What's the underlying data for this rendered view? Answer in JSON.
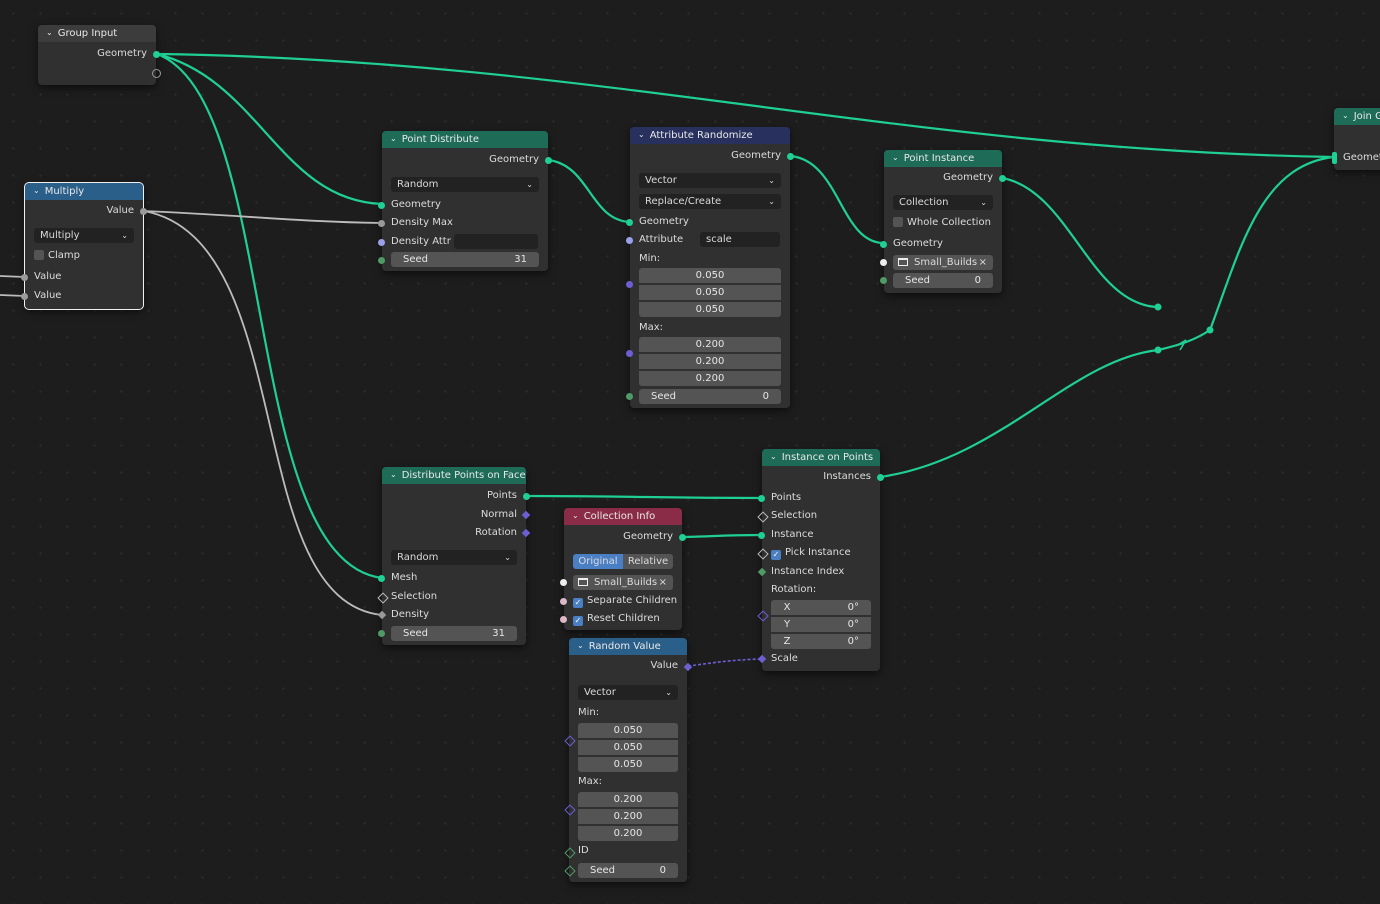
{
  "nodes": {
    "group_input": {
      "title": "Group Input",
      "geometry": "Geometry"
    },
    "multiply": {
      "title": "Multiply",
      "value_out": "Value",
      "operation": "Multiply",
      "clamp": "Clamp",
      "value_in_1": "Value",
      "value_in_2": "Value"
    },
    "point_distribute": {
      "title": "Point Distribute",
      "geometry_out": "Geometry",
      "mode": "Random",
      "geometry_in": "Geometry",
      "density_max": "Density Max",
      "density_attr": "Density Attr",
      "seed_label": "Seed",
      "seed_value": "31"
    },
    "attribute_randomize": {
      "title": "Attribute Randomize",
      "geometry_out": "Geometry",
      "type": "Vector",
      "operation": "Replace/Create",
      "geometry_in": "Geometry",
      "attribute_label": "Attribute",
      "attribute_value": "scale",
      "min_label": "Min:",
      "min": [
        "0.050",
        "0.050",
        "0.050"
      ],
      "max_label": "Max:",
      "max": [
        "0.200",
        "0.200",
        "0.200"
      ],
      "seed_label": "Seed",
      "seed_value": "0"
    },
    "point_instance": {
      "title": "Point Instance",
      "geometry_out": "Geometry",
      "mode": "Collection",
      "whole_collection": "Whole Collection",
      "geometry_in": "Geometry",
      "collection": "Small_Builds",
      "seed_label": "Seed",
      "seed_value": "0"
    },
    "join_geometry": {
      "title": "Join G",
      "geometry": "Geomet"
    },
    "distribute_points": {
      "title": "Distribute Points on Faces",
      "points": "Points",
      "normal": "Normal",
      "rotation": "Rotation",
      "mode": "Random",
      "mesh": "Mesh",
      "selection": "Selection",
      "density": "Density",
      "seed_label": "Seed",
      "seed_value": "31"
    },
    "collection_info": {
      "title": "Collection Info",
      "geometry": "Geometry",
      "original": "Original",
      "relative": "Relative",
      "collection": "Small_Builds",
      "separate_children": "Separate Children",
      "reset_children": "Reset Children"
    },
    "random_value": {
      "title": "Random Value",
      "value": "Value",
      "type": "Vector",
      "min_label": "Min:",
      "min": [
        "0.050",
        "0.050",
        "0.050"
      ],
      "max_label": "Max:",
      "max": [
        "0.200",
        "0.200",
        "0.200"
      ],
      "id": "ID",
      "seed_label": "Seed",
      "seed_value": "0"
    },
    "instance_on_points": {
      "title": "Instance on Points",
      "instances": "Instances",
      "points": "Points",
      "selection": "Selection",
      "instance": "Instance",
      "pick_instance": "Pick Instance",
      "instance_index": "Instance Index",
      "rotation_label": "Rotation:",
      "rot_x_label": "X",
      "rot_x": "0°",
      "rot_y_label": "Y",
      "rot_y": "0°",
      "rot_z_label": "Z",
      "rot_z": "0°",
      "scale": "Scale"
    }
  },
  "colors": {
    "geometry_link": "#1fcf95",
    "value_link": "#b9b9b9",
    "vector_link": "#6c5fd4"
  }
}
